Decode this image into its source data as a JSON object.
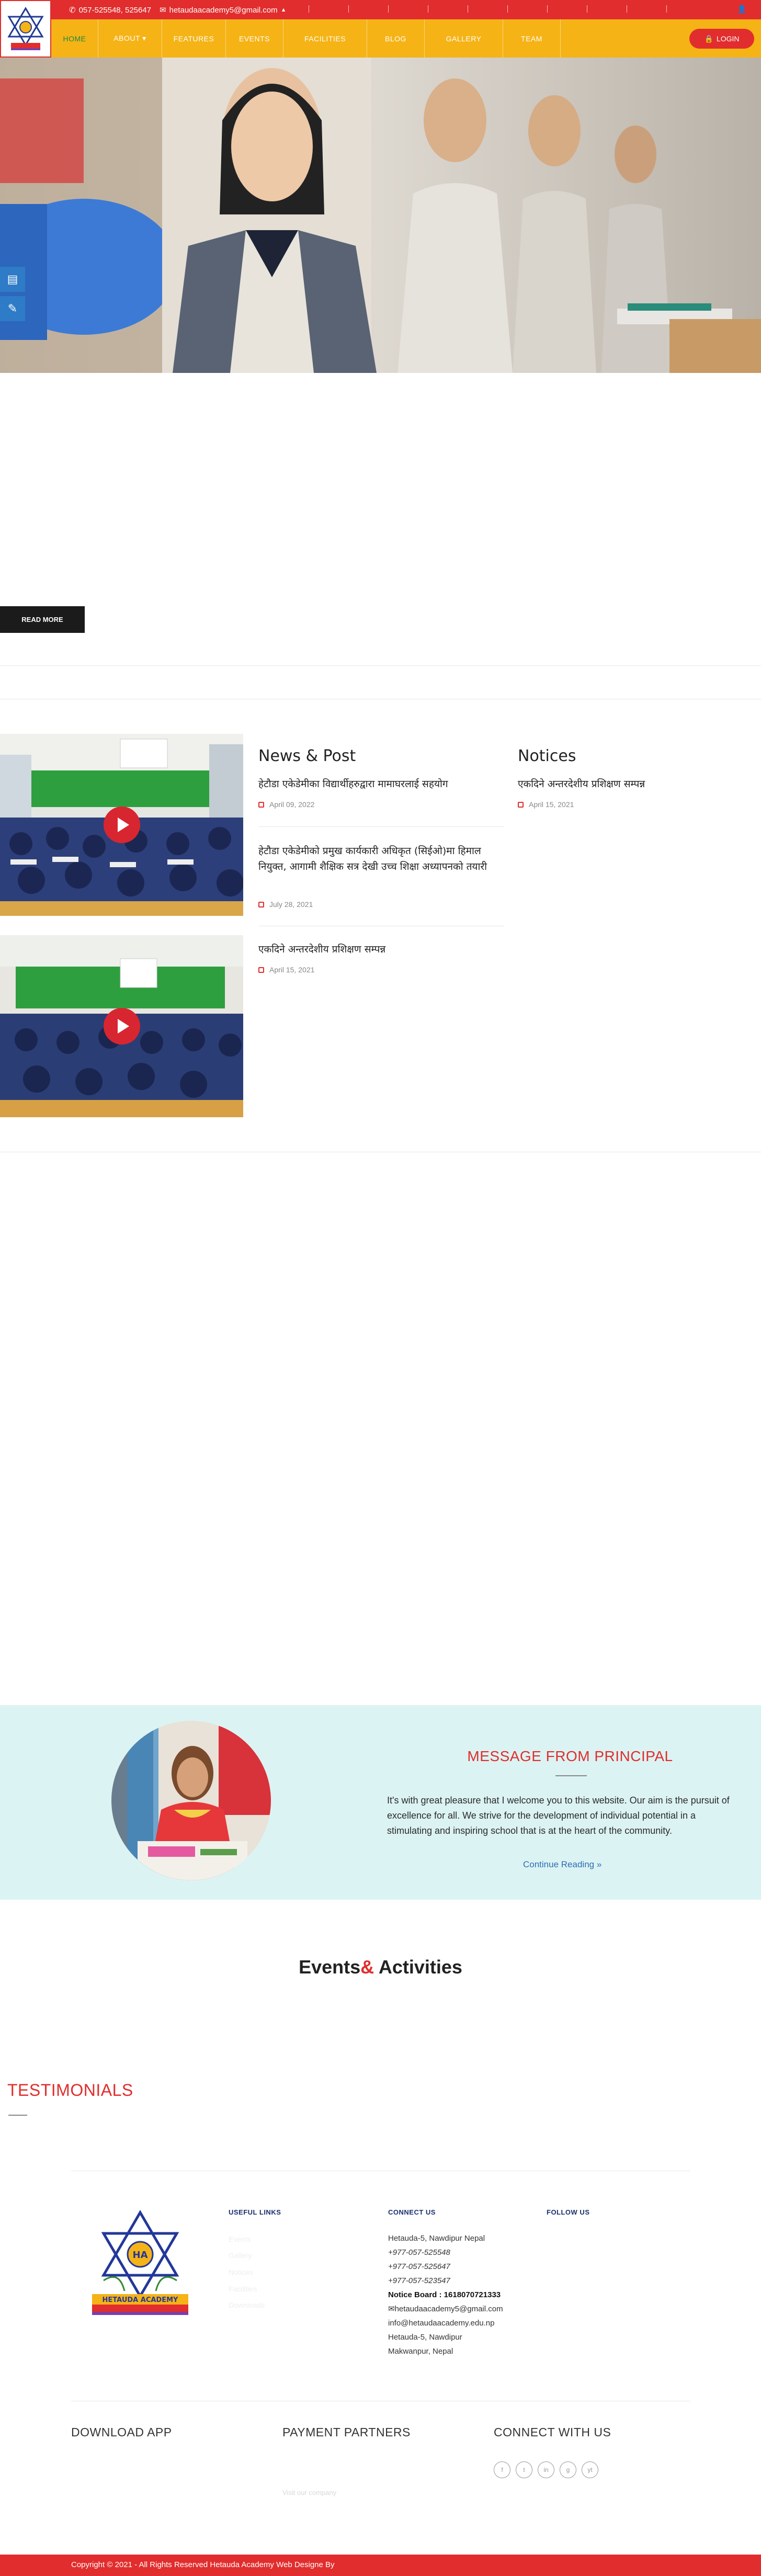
{
  "topbar": {
    "phone": "057-525548, 525647",
    "email": "hetaudaacademy5@gmail.com"
  },
  "nav": {
    "items": [
      {
        "label": "HOME"
      },
      {
        "label": "ABOUT ▾"
      },
      {
        "label": "FEATURES"
      },
      {
        "label": "EVENTS"
      },
      {
        "label": "FACILITIES"
      },
      {
        "label": "BLOG"
      },
      {
        "label": "GALLERY"
      },
      {
        "label": "TEAM"
      }
    ],
    "login": "LOGIN"
  },
  "hero": {
    "read_more": "READ MORE"
  },
  "news": {
    "title": "News & Post",
    "items": [
      {
        "title": "हेटौडा एकेडेमीका विद्यार्थीहरुद्वारा मामाघरलाई सहयोग",
        "date": "April 09, 2022"
      },
      {
        "title": "हेटौडा एकेडेमीको प्रमुख कार्यकारी अधिकृत (सिईओ)मा हिमाल नियुक्त, आगामी शैक्षिक सत्र देखी उच्च शिक्षा अध्यापनको तयारी",
        "date": "July 28, 2021"
      },
      {
        "title": "एकदिने अन्तरदेशीय प्रशिक्षण सम्पन्न",
        "date": "April 15, 2021"
      }
    ]
  },
  "notices": {
    "title": "Notices",
    "items": [
      {
        "title": "एकदिने अन्तरदेशीय प्रशिक्षण सम्पन्न",
        "date": "April 15, 2021"
      }
    ]
  },
  "principal": {
    "heading": "MESSAGE FROM PRINCIPAL",
    "message": "It's with great pleasure that I welcome you to this website. Our aim is the pursuit of excellence for all. We strive for the development of individual potential in a stimulating and inspiring school that is at the heart of the community.",
    "continue": "Continue Reading »"
  },
  "events": {
    "title_a": "Events",
    "title_amp": "&",
    "title_b": " Activities"
  },
  "testimonials": {
    "title": "TESTIMONIALS"
  },
  "footer": {
    "logo_text": "HETAUDA ACADEMY",
    "useful_links_head": "USEFUL LINKS",
    "useful_links": [
      "Events",
      "Gallery",
      "Notices",
      "Facilities",
      "Downloads"
    ],
    "connect_head": "CONNECT US",
    "address": "Hetauda-5, Nawdipur Nepal",
    "phones": [
      "+977-057-525548",
      "+977-057-525647",
      "+977-057-523547"
    ],
    "notice_board": "Notice Board : 1618070721333",
    "email1": "hetaudaacademy5@gmail.com",
    "email2": "info@hetaudaacademy.edu.np",
    "address2": "Hetauda-5, Nawdipur",
    "address3": "Makwanpur, Nepal",
    "follow_head": "FOLLOW US",
    "download_app": "DOWNLOAD APP",
    "payment": "PAYMENT PARTNERS",
    "payment_sub": "Visit our company",
    "connect_with": "CONNECT WITH US",
    "social": [
      "f",
      "t",
      "in",
      "g",
      "yt"
    ],
    "copyright": "Copyright © 2021 - All Rights Reserved Hetauda Academy Web Designe By"
  }
}
